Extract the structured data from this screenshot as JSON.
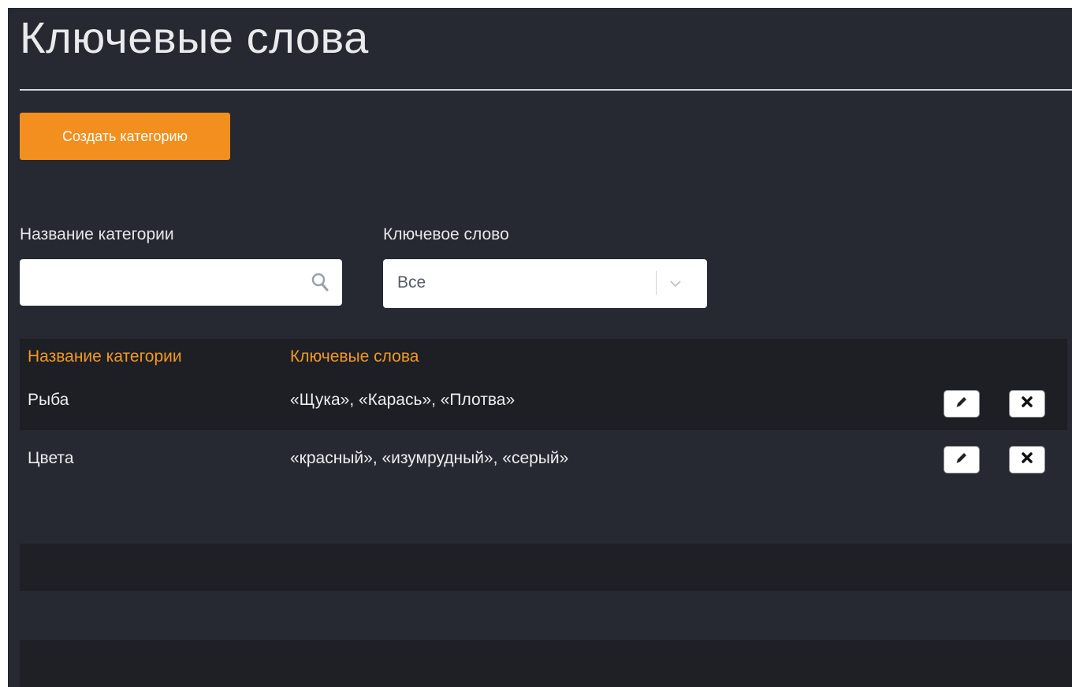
{
  "page": {
    "title": "Ключевые слова"
  },
  "toolbar": {
    "create_label": "Создать категорию"
  },
  "filters": {
    "category_label": "Название категории",
    "category_value": "",
    "keyword_label": "Ключевое слово",
    "keyword_selected": "Все"
  },
  "table": {
    "columns": [
      "Название категории",
      "Ключевые слова"
    ],
    "rows": [
      {
        "name": "Рыба",
        "keywords": "«Щука», «Карась», «Плотва»"
      },
      {
        "name": "Цвета",
        "keywords": "«красный», «изумрудный», «серый»"
      }
    ]
  },
  "icons": {
    "search": "search-icon",
    "dropdown": "chevron-down-icon",
    "edit": "pencil-icon",
    "delete": "close-icon"
  },
  "colors": {
    "background": "#262932",
    "accent": "#f28f1e",
    "header_text": "#f2991f",
    "table_panel": "#1d1f25"
  }
}
